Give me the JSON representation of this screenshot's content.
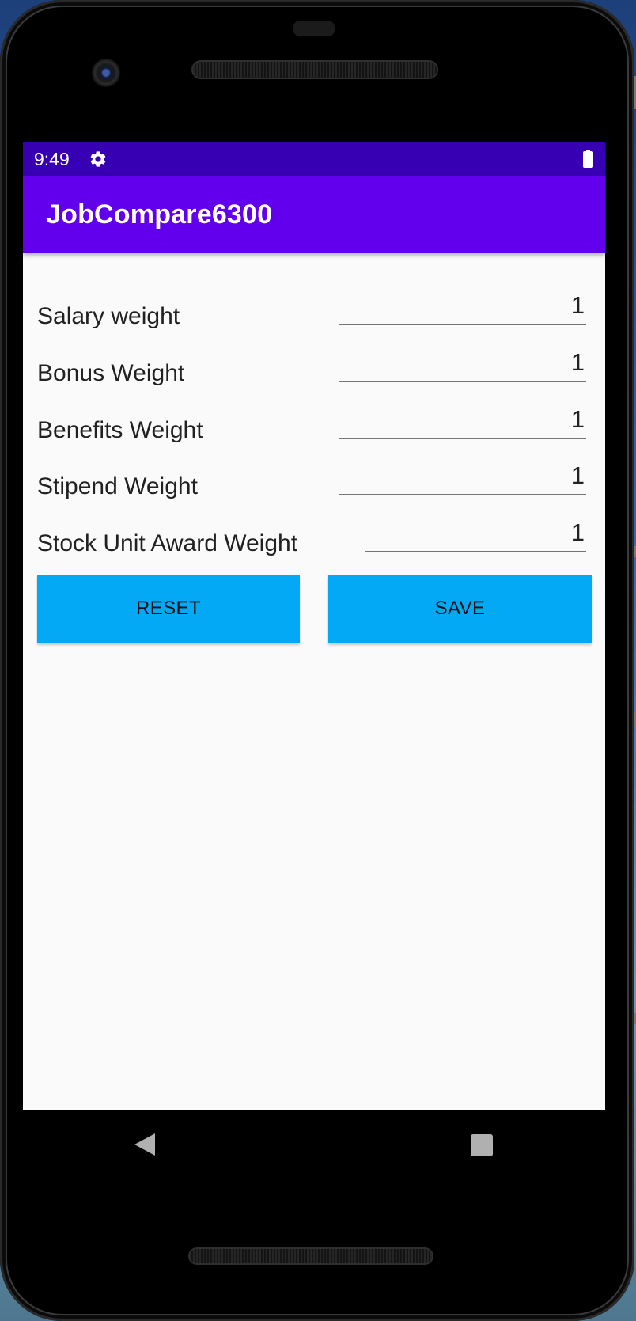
{
  "status_bar": {
    "time": "9:49",
    "icons": [
      "gear-icon",
      "battery-icon"
    ]
  },
  "app_bar": {
    "title": "JobCompare6300"
  },
  "weights": [
    {
      "label": "Salary weight",
      "value": "1"
    },
    {
      "label": "Bonus Weight",
      "value": "1"
    },
    {
      "label": "Benefits Weight",
      "value": "1"
    },
    {
      "label": "Stipend Weight",
      "value": "1"
    },
    {
      "label": "Stock Unit Award Weight",
      "value": "1"
    }
  ],
  "buttons": {
    "reset": "RESET",
    "save": "SAVE"
  },
  "navigation": {
    "icons": [
      "back-icon",
      "recents-icon"
    ]
  },
  "colors": {
    "status_bar": "#3700b3",
    "app_bar": "#6200ee",
    "button": "#03a9f4",
    "screen_background": "#fafafa"
  }
}
